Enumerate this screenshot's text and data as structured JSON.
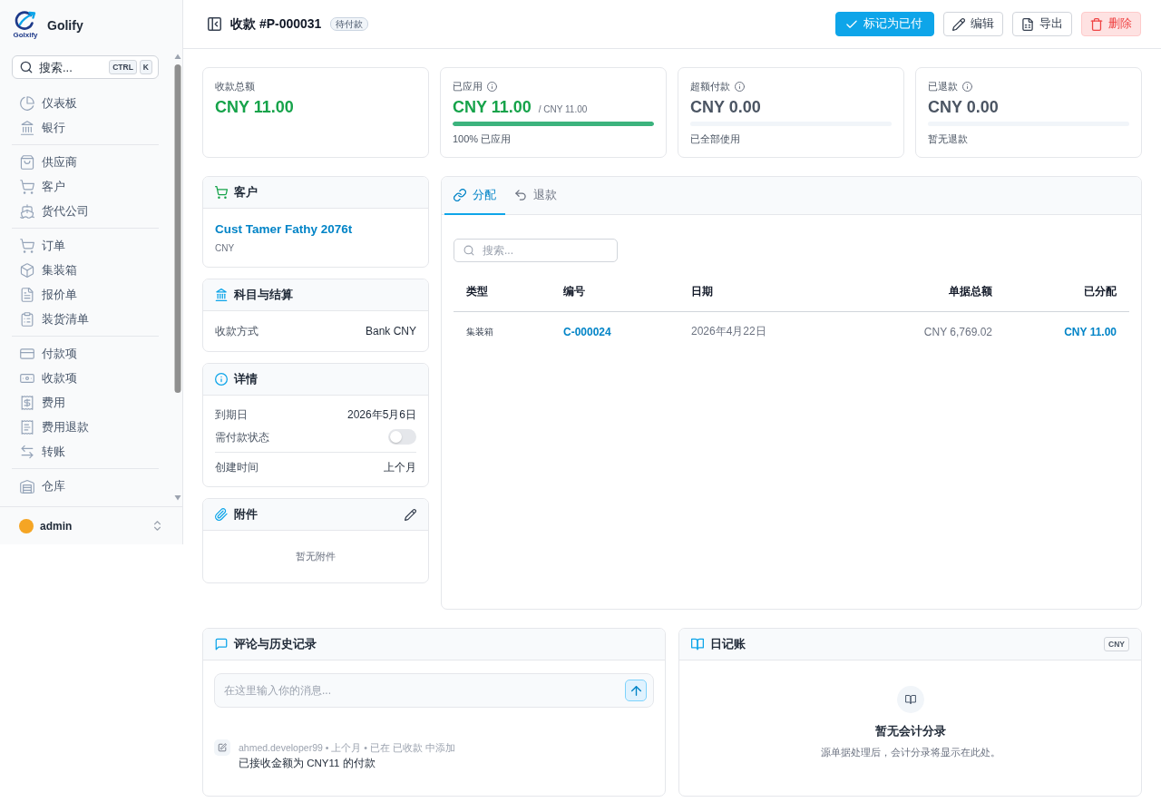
{
  "sidebar": {
    "brand": {
      "name": "Golify",
      "logo_caption": "Golxify"
    },
    "search": {
      "placeholder": "搜索...",
      "shortcut": [
        "CTRL",
        "K"
      ]
    },
    "nav_groups": [
      {
        "items": [
          {
            "label": "仪表板",
            "selected": false
          },
          {
            "label": "银行",
            "selected": false
          }
        ]
      },
      {
        "items": [
          {
            "label": "供应商",
            "selected": false
          },
          {
            "label": "客户",
            "selected": false
          },
          {
            "label": "货代公司",
            "selected": false
          }
        ]
      },
      {
        "items": [
          {
            "label": "订单",
            "selected": false
          },
          {
            "label": "集装箱",
            "selected": false
          },
          {
            "label": "报价单",
            "selected": false
          },
          {
            "label": "装货清单",
            "selected": false
          }
        ]
      },
      {
        "items": [
          {
            "label": "付款项",
            "selected": false
          },
          {
            "label": "收款项",
            "selected": false
          },
          {
            "label": "费用",
            "selected": false
          },
          {
            "label": "费用退款",
            "selected": false
          },
          {
            "label": "转账",
            "selected": false
          }
        ]
      },
      {
        "items": [
          {
            "label": "仓库",
            "selected": false
          }
        ]
      }
    ],
    "user": {
      "name": "admin"
    }
  },
  "header": {
    "title": "收款 #P-000031",
    "status": "待付款",
    "actions": [
      {
        "label": "标记为已付",
        "kind": "primary"
      },
      {
        "label": "编辑",
        "kind": "default"
      },
      {
        "label": "导出",
        "kind": "default"
      },
      {
        "label": "删除",
        "kind": "danger"
      }
    ]
  },
  "stats": [
    {
      "label": "收款总额",
      "info": false,
      "value": "CNY 11.00",
      "color": "#16a34a"
    },
    {
      "label": "已应用",
      "info": true,
      "value": "CNY 11.00",
      "color": "#16a34a",
      "of_total": "/ CNY 11.00",
      "level": 1,
      "note": "100% 已应用"
    },
    {
      "label": "超额付款",
      "info": true,
      "value": "CNY 0.00",
      "color": "#4b5563",
      "level": 0,
      "note": "已全部使用"
    },
    {
      "label": "已退款",
      "info": true,
      "value": "CNY 0.00",
      "color": "#4b5563",
      "level": 0,
      "note": "暂无退款"
    }
  ],
  "customer": {
    "title": "客户",
    "name": "Cust Tamer Fathy 2076t",
    "currency": "CNY"
  },
  "accounts": {
    "title": "科目与结算",
    "rows": [
      {
        "label": "收款方式",
        "value": "Bank CNY"
      }
    ]
  },
  "details": {
    "title": "详情",
    "rows": [
      {
        "kind": "text",
        "label": "到期日",
        "value": "2026年5月6日"
      },
      {
        "kind": "toggle",
        "label": "需付款状态",
        "on": false
      },
      {
        "kind": "text",
        "label": "创建时间",
        "value": "上个月"
      }
    ]
  },
  "attachments": {
    "title": "附件",
    "empty": "暂无附件"
  },
  "allocation_panel": {
    "tabs": [
      {
        "label": "分配",
        "selected": true
      },
      {
        "label": "退款",
        "selected": false
      }
    ],
    "search": {
      "placeholder": "搜索..."
    },
    "table": {
      "columns": [
        "类型",
        "编号",
        "日期",
        "单据总额",
        "已分配"
      ],
      "rows": [
        {
          "type": "集装箱",
          "number": "C-000024",
          "date": "2026年4月22日",
          "document_total": "CNY 6,769.02",
          "allocated": "CNY 11.00"
        }
      ]
    }
  },
  "comments": {
    "title": "评论与历史记录",
    "input": {
      "placeholder": "在这里输入你的消息..."
    },
    "entries": [
      {
        "meta": "ahmed.developer99 • 上个月 • 已在 已收款 中添加",
        "text": "已接收金额为 CNY11 的付款"
      }
    ]
  },
  "journal": {
    "title": "日记账",
    "currency": "CNY",
    "empty_title": "暂无会计分录",
    "empty_text": "源单据处理后，会计分录将显示在此处。"
  }
}
